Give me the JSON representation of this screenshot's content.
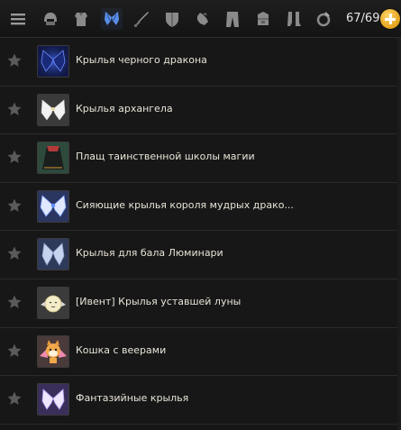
{
  "toolbar": {
    "icons": [
      {
        "name": "menu-icon"
      },
      {
        "name": "helmet-icon"
      },
      {
        "name": "armor-icon"
      },
      {
        "name": "wings-icon"
      },
      {
        "name": "weapon-icon"
      },
      {
        "name": "shield-icon"
      },
      {
        "name": "gloves-icon"
      },
      {
        "name": "pants-icon"
      },
      {
        "name": "chest-icon"
      },
      {
        "name": "boots-icon"
      },
      {
        "name": "ring-icon"
      }
    ],
    "counter": "67/69",
    "add_button": "add-icon"
  },
  "items": [
    {
      "label": "Крылья черного дракона",
      "icon": "black-dragon-wings-icon"
    },
    {
      "label": "Крылья архангела",
      "icon": "archangel-wings-icon"
    },
    {
      "label": "Плащ таинственной школы магии",
      "icon": "magic-school-cloak-icon"
    },
    {
      "label": "Сияющие крылья короля мудрых драко...",
      "icon": "radiant-dragon-king-wings-icon"
    },
    {
      "label": "Крылья для бала Люминари",
      "icon": "luminary-ball-wings-icon"
    },
    {
      "label": "[Ивент] Крылья уставшей луны",
      "icon": "tired-moon-wings-icon"
    },
    {
      "label": "Кошка с веерами",
      "icon": "cat-with-fans-icon"
    },
    {
      "label": "Фантазийные крылья",
      "icon": "fantasy-wings-icon"
    }
  ]
}
